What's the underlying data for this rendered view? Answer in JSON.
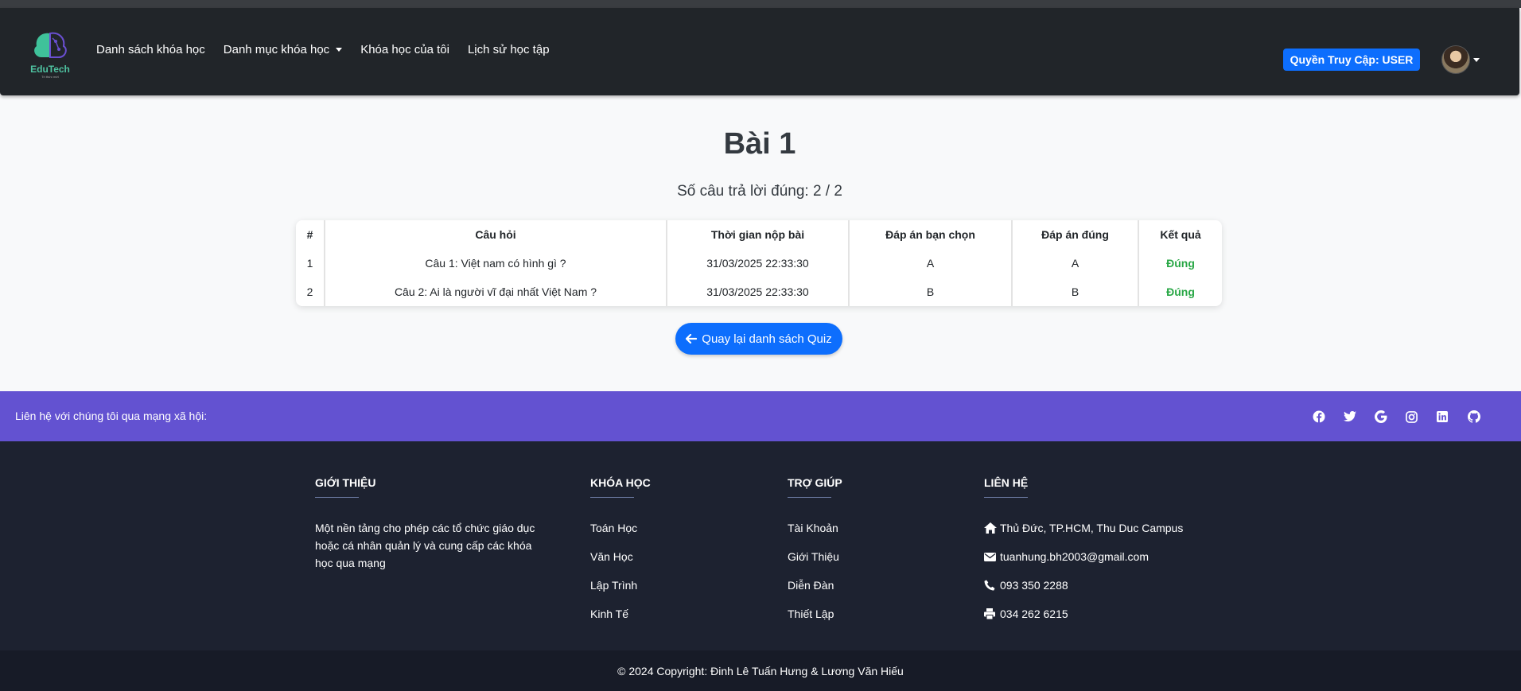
{
  "brand": {
    "logo_text": "EduTech",
    "logo_sub": "Tri thức mới"
  },
  "nav": {
    "items": [
      {
        "label": "Danh sách khóa học"
      },
      {
        "label": "Danh mục khóa học",
        "dropdown": true
      },
      {
        "label": "Khóa học của tôi"
      },
      {
        "label": "Lịch sử học tập"
      }
    ],
    "role_badge": "Quyền Truy Cập: USER"
  },
  "quiz": {
    "title": "Bài 1",
    "score_text": "Số câu trả lời đúng: 2 / 2",
    "columns": [
      "#",
      "Câu hỏi",
      "Thời gian nộp bài",
      "Đáp án bạn chọn",
      "Đáp án đúng",
      "Kết quả"
    ],
    "rows": [
      {
        "num": "1",
        "question": "Câu 1: Việt nam có hình gì ?",
        "time": "31/03/2025 22:33:30",
        "chosen": "A",
        "correct": "A",
        "result": "Đúng"
      },
      {
        "num": "2",
        "question": "Câu 2: Ai là người vĩ đại nhất Việt Nam ?",
        "time": "31/03/2025 22:33:30",
        "chosen": "B",
        "correct": "B",
        "result": "Đúng"
      }
    ],
    "back_label": "Quay lại danh sách Quiz"
  },
  "social": {
    "text": "Liên hệ với chúng tôi qua mạng xã hội:",
    "icons": [
      "facebook-icon",
      "twitter-icon",
      "google-icon",
      "instagram-icon",
      "linkedin-icon",
      "github-icon"
    ]
  },
  "footer": {
    "about": {
      "title": "GIỚI THIỆU",
      "text": "Một nền tảng cho phép các tổ chức giáo dục hoặc cá nhân quản lý và cung cấp các khóa học qua mạng"
    },
    "courses": {
      "title": "KHÓA HỌC",
      "items": [
        "Toán Học",
        "Văn Học",
        "Lập Trình",
        "Kinh Tế"
      ]
    },
    "help": {
      "title": "TRỢ GIÚP",
      "items": [
        "Tài Khoản",
        "Giới Thiệu",
        "Diễn Đàn",
        "Thiết Lập"
      ]
    },
    "contact": {
      "title": "LIÊN HỆ",
      "address": "Thủ Đức, TP.HCM, Thu Duc Campus",
      "email": "tuanhung.bh2003@gmail.com",
      "phone": "093 350 2288",
      "fax": "034 262 6215"
    },
    "copyright": "© 2024 Copyright: Đinh Lê Tuấn Hưng & Lương Văn Hiếu"
  },
  "colors": {
    "navbar": "#212529",
    "primary": "#0d6efd",
    "social_bar": "#6352d1",
    "footer": "#1d2230",
    "success": "#28a745"
  }
}
